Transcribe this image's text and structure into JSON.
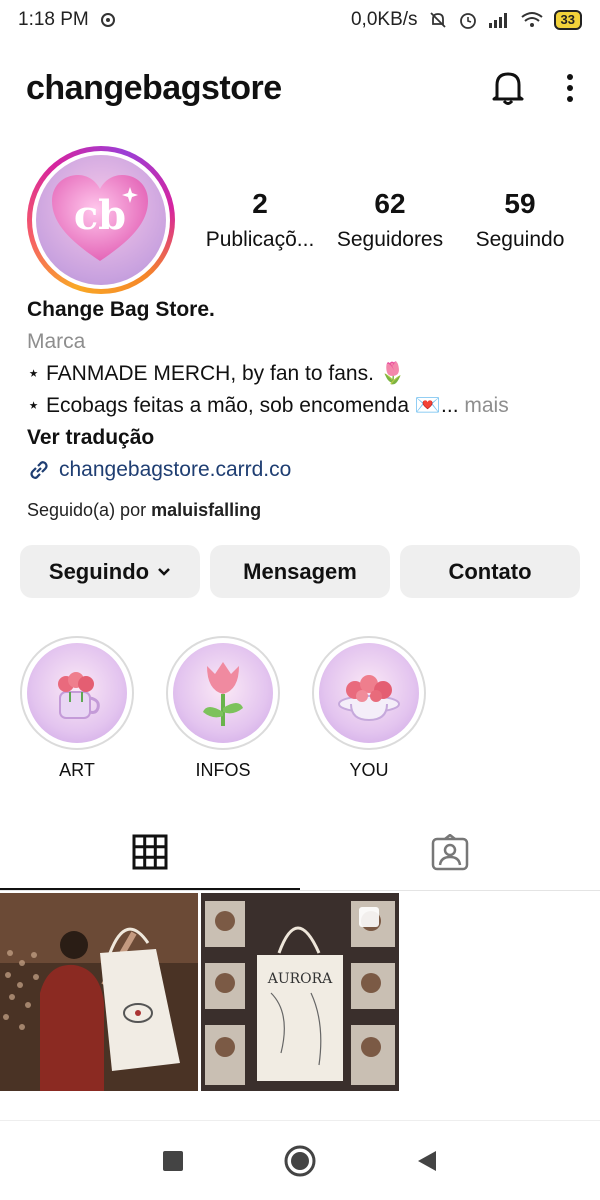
{
  "status_bar": {
    "time": "1:18 PM",
    "network_speed": "0,0KB/s",
    "battery": "33"
  },
  "header": {
    "username": "changebagstore"
  },
  "profile": {
    "avatar_text": "cb",
    "stats": [
      {
        "value": "2",
        "label": "Publicaçõ..."
      },
      {
        "value": "62",
        "label": "Seguidores"
      },
      {
        "value": "59",
        "label": "Seguindo"
      }
    ]
  },
  "bio": {
    "name": "Change Bag Store.",
    "category": "Marca",
    "line1": "⋆ FANMADE MERCH, by fan to fans. 🌷",
    "line2": "⋆ Ecobags feitas a mão, sob encomenda 💌...",
    "more": " mais",
    "translate": "Ver tradução",
    "link": "changebagstore.carrd.co"
  },
  "followed_by": {
    "prefix": "Seguido(a) por ",
    "user": "maluisfalling"
  },
  "buttons": {
    "following": "Seguindo",
    "message": "Mensagem",
    "contact": "Contato"
  },
  "highlights": [
    {
      "label": "ART"
    },
    {
      "label": "INFOS"
    },
    {
      "label": "YOU"
    }
  ],
  "colors": {
    "link": "#1f3e72",
    "button_bg": "#efefef",
    "muted": "#8e8e8e"
  }
}
